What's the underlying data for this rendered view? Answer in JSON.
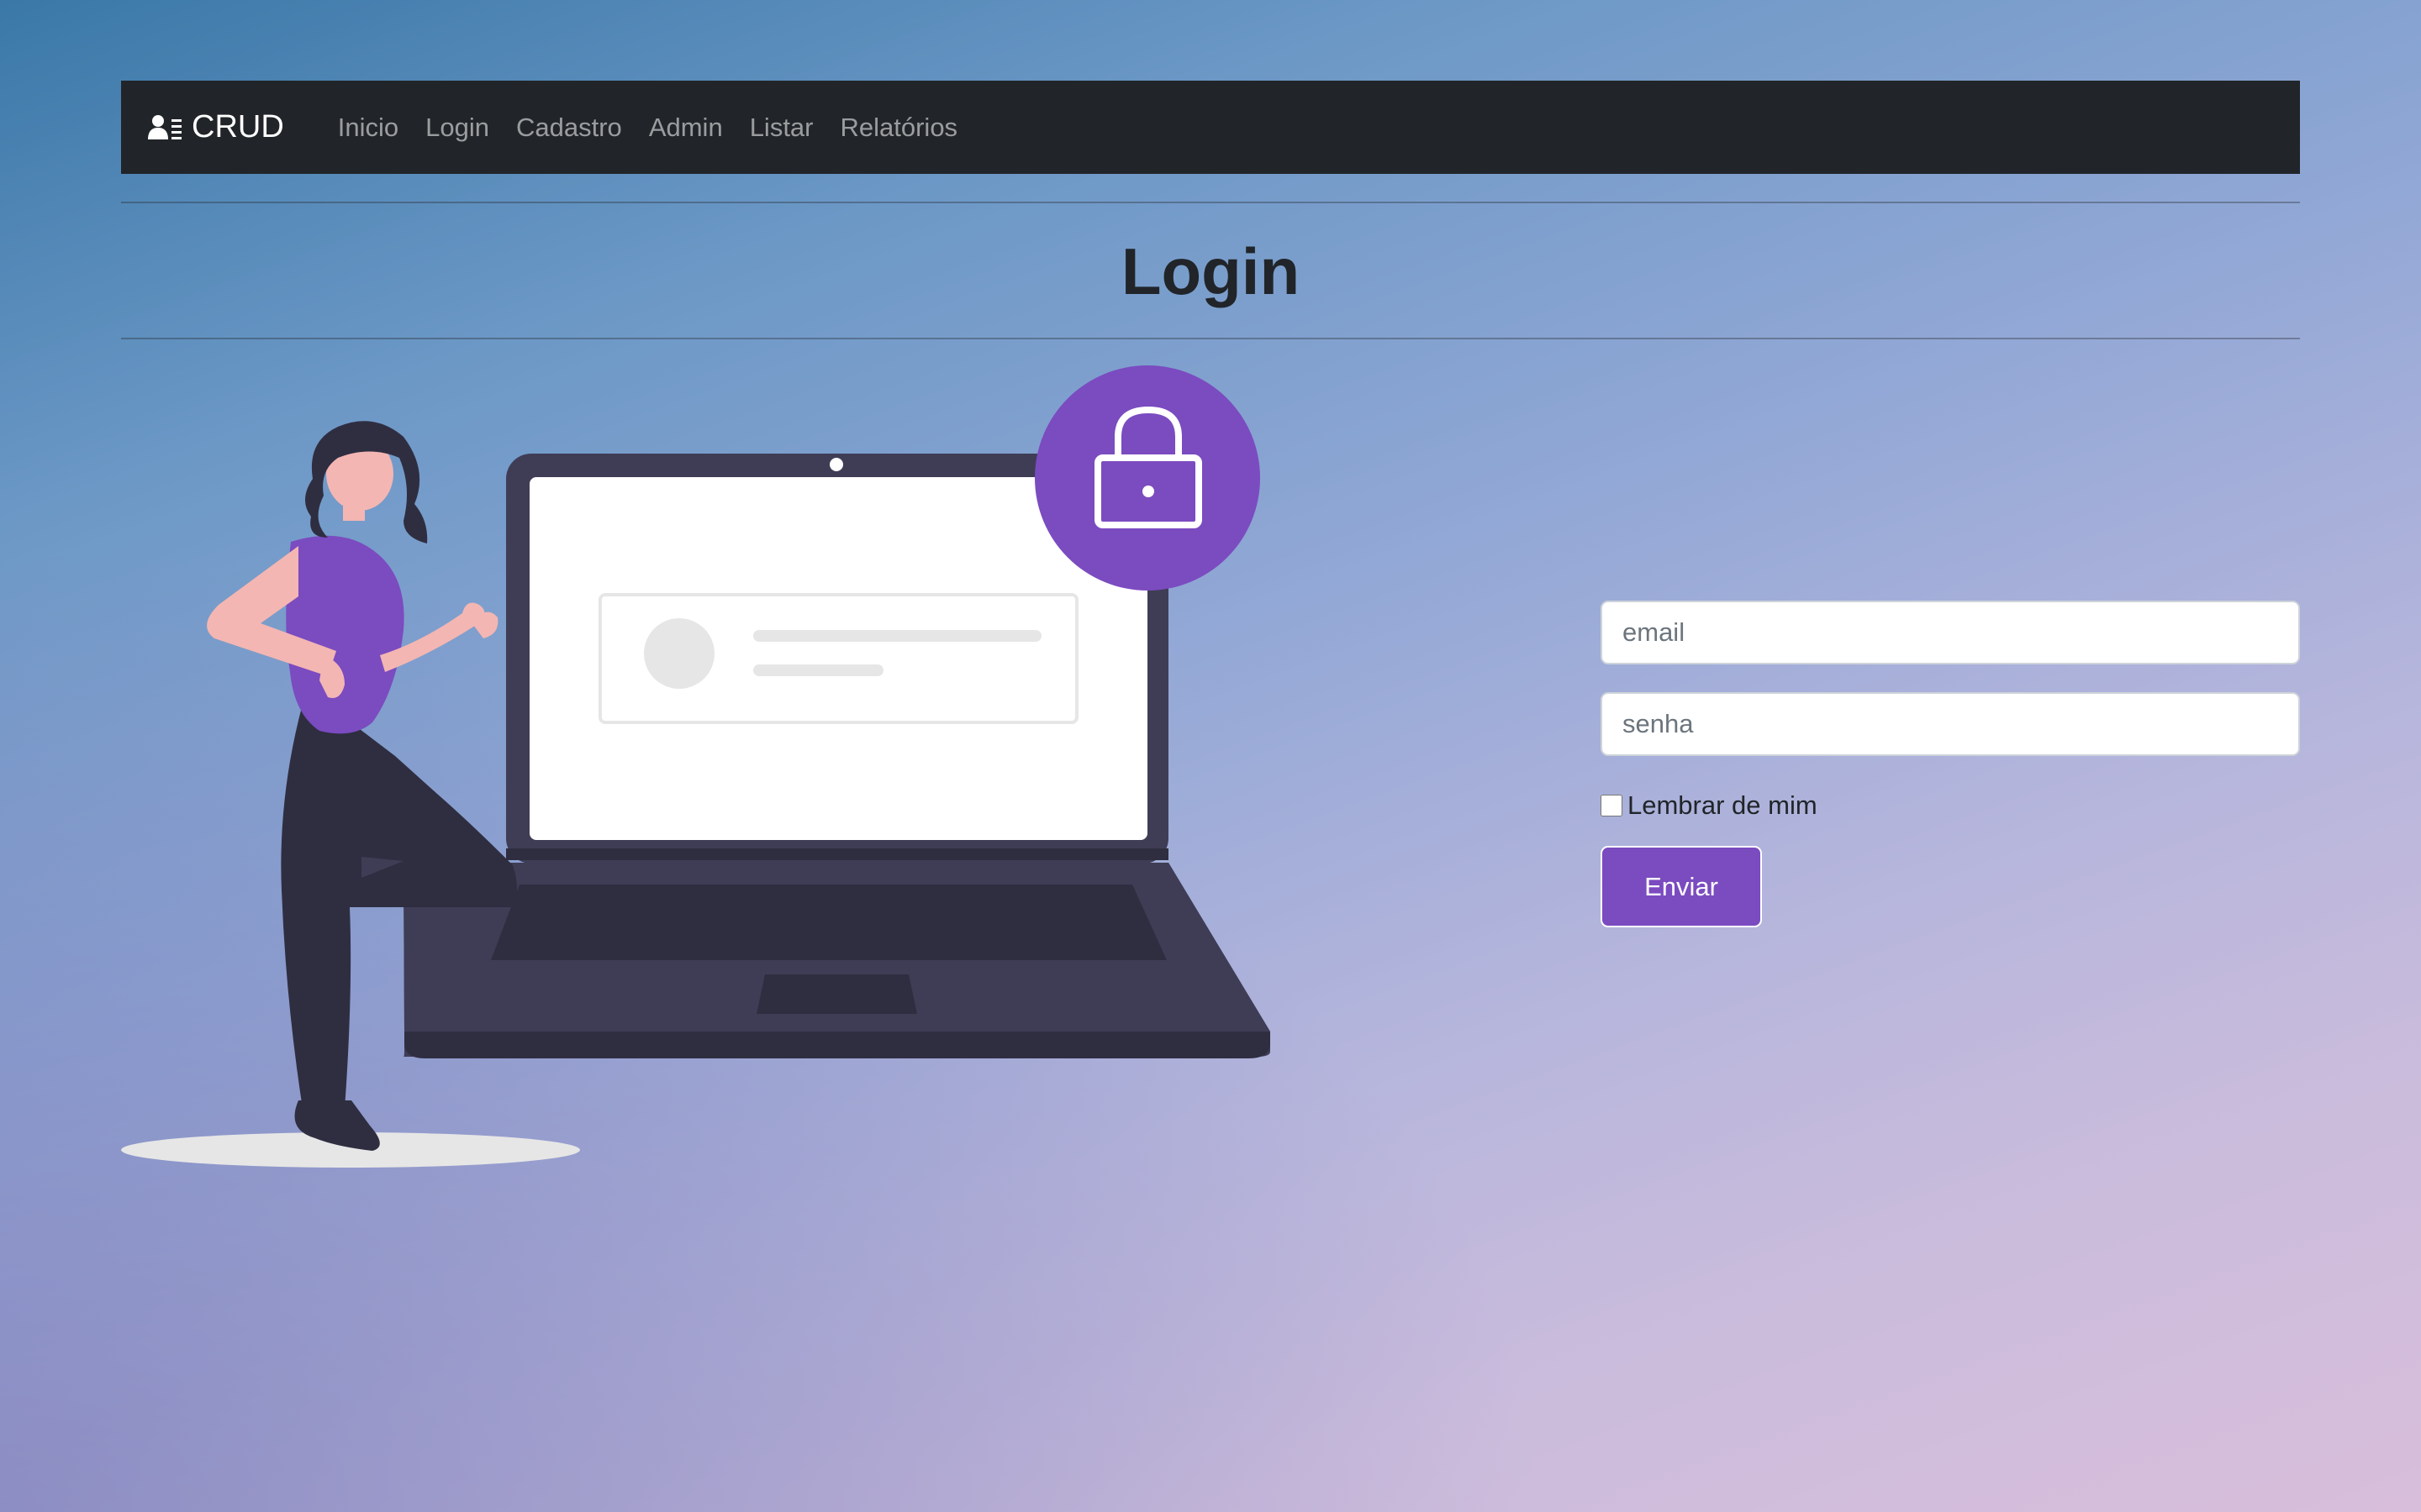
{
  "navbar": {
    "brand_icon": "user-list-icon",
    "brand_label": "CRUD",
    "links": [
      {
        "label": "Inicio"
      },
      {
        "label": "Login"
      },
      {
        "label": "Cadastro"
      },
      {
        "label": "Admin"
      },
      {
        "label": "Listar"
      },
      {
        "label": "Relatórios"
      }
    ]
  },
  "page": {
    "title": "Login"
  },
  "illustration": {
    "icon": "lock-icon",
    "description_name": "woman-with-laptop-illustration"
  },
  "form": {
    "email_placeholder": "email",
    "password_placeholder": "senha",
    "remember_label": "Lembrar de mim",
    "remember_checked": false,
    "submit_label": "Enviar"
  },
  "colors": {
    "accent": "#7b4bc0",
    "navbar_bg": "#212529",
    "laptop_dark": "#3f3d56",
    "laptop_darker": "#2f2e41"
  }
}
